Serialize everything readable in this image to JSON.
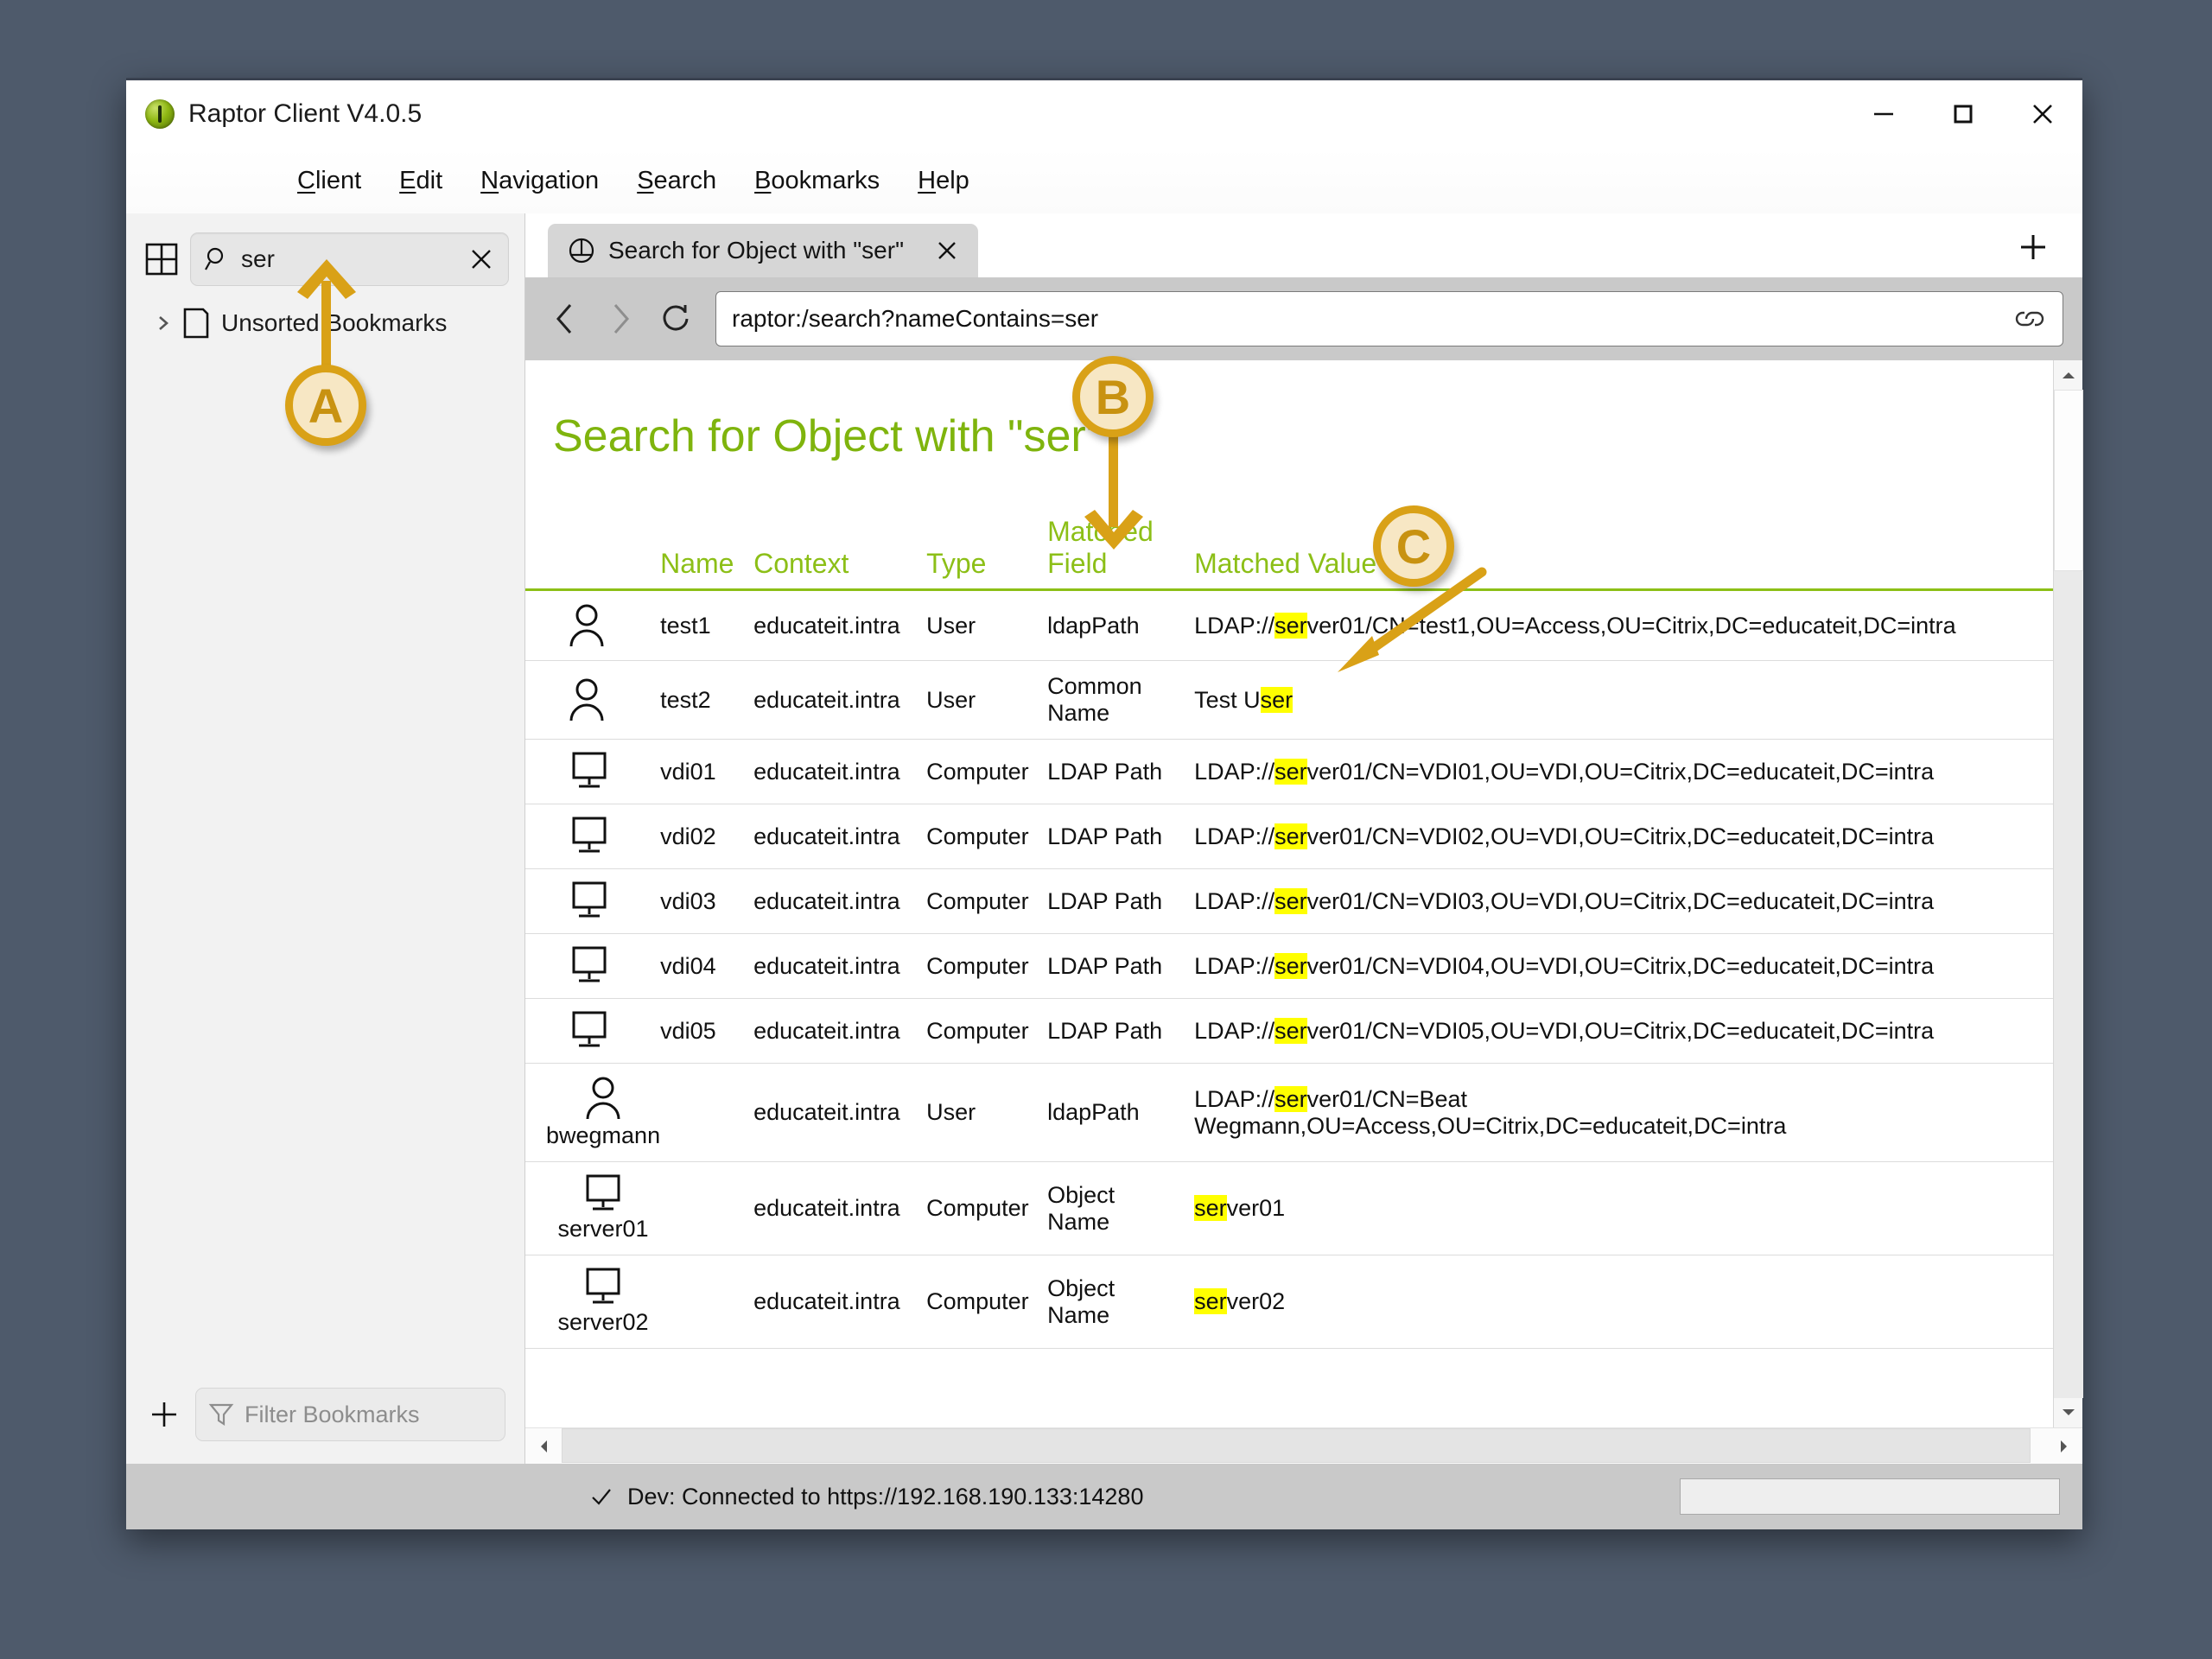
{
  "window": {
    "title": "Raptor Client V4.0.5",
    "controls": {
      "minimize": "minimize-button",
      "maximize": "maximize-button",
      "close": "close-button"
    }
  },
  "menubar": [
    {
      "label": "Client",
      "mnemonic": "C"
    },
    {
      "label": "Edit",
      "mnemonic": "E"
    },
    {
      "label": "Navigation",
      "mnemonic": "N"
    },
    {
      "label": "Search",
      "mnemonic": "S"
    },
    {
      "label": "Bookmarks",
      "mnemonic": "B"
    },
    {
      "label": "Help",
      "mnemonic": "H"
    }
  ],
  "sidebar": {
    "search": {
      "value": "ser",
      "placeholder": ""
    },
    "tree": [
      {
        "label": "Unsorted Bookmarks"
      }
    ],
    "filter": {
      "placeholder": "Filter Bookmarks"
    },
    "add_label": "+"
  },
  "tabs": {
    "active": "Search for Object with \"ser\"",
    "new_tab_label": "+"
  },
  "navbar": {
    "url": "raptor:/search?nameContains=ser"
  },
  "page": {
    "heading": "Search for Object with \"ser\"",
    "columns": [
      "",
      "Name",
      "Context",
      "Type",
      "Matched Field",
      "Matched Value"
    ],
    "rows": [
      {
        "icon": "user-icon",
        "name": "test1",
        "name_layout": "inline",
        "context": "educateit.intra",
        "type": "User",
        "field": "ldapPath",
        "value_pre": "LDAP://",
        "value_hl": "ser",
        "value_post": "ver01/CN=test1,OU=Access,OU=Citrix,DC=educateit,DC=intra"
      },
      {
        "icon": "user-icon",
        "name": "test2",
        "name_layout": "inline",
        "context": "educateit.intra",
        "type": "User",
        "field": "Common Name",
        "value_pre": "Test U",
        "value_hl": "ser",
        "value_post": ""
      },
      {
        "icon": "computer-icon",
        "name": "vdi01",
        "name_layout": "inline",
        "context": "educateit.intra",
        "type": "Computer",
        "field": "LDAP Path",
        "value_pre": "LDAP://",
        "value_hl": "ser",
        "value_post": "ver01/CN=VDI01,OU=VDI,OU=Citrix,DC=educateit,DC=intra"
      },
      {
        "icon": "computer-icon",
        "name": "vdi02",
        "name_layout": "inline",
        "context": "educateit.intra",
        "type": "Computer",
        "field": "LDAP Path",
        "value_pre": "LDAP://",
        "value_hl": "ser",
        "value_post": "ver01/CN=VDI02,OU=VDI,OU=Citrix,DC=educateit,DC=intra"
      },
      {
        "icon": "computer-icon",
        "name": "vdi03",
        "name_layout": "inline",
        "context": "educateit.intra",
        "type": "Computer",
        "field": "LDAP Path",
        "value_pre": "LDAP://",
        "value_hl": "ser",
        "value_post": "ver01/CN=VDI03,OU=VDI,OU=Citrix,DC=educateit,DC=intra"
      },
      {
        "icon": "computer-icon",
        "name": "vdi04",
        "name_layout": "inline",
        "context": "educateit.intra",
        "type": "Computer",
        "field": "LDAP Path",
        "value_pre": "LDAP://",
        "value_hl": "ser",
        "value_post": "ver01/CN=VDI04,OU=VDI,OU=Citrix,DC=educateit,DC=intra"
      },
      {
        "icon": "computer-icon",
        "name": "vdi05",
        "name_layout": "inline",
        "context": "educateit.intra",
        "type": "Computer",
        "field": "LDAP Path",
        "value_pre": "LDAP://",
        "value_hl": "ser",
        "value_post": "ver01/CN=VDI05,OU=VDI,OU=Citrix,DC=educateit,DC=intra"
      },
      {
        "icon": "user-icon",
        "name": "bwegmann",
        "name_layout": "stacked",
        "context": "educateit.intra",
        "type": "User",
        "field": "ldapPath",
        "value_pre": "LDAP://",
        "value_hl": "ser",
        "value_post": "ver01/CN=Beat Wegmann,OU=Access,OU=Citrix,DC=educateit,DC=intra"
      },
      {
        "icon": "computer-icon",
        "name": "server01",
        "name_layout": "stacked",
        "context": "educateit.intra",
        "type": "Computer",
        "field": "Object Name",
        "value_pre": "",
        "value_hl": "ser",
        "value_post": "ver01"
      },
      {
        "icon": "computer-icon",
        "name": "server02",
        "name_layout": "stacked",
        "context": "educateit.intra",
        "type": "Computer",
        "field": "Object Name",
        "value_pre": "",
        "value_hl": "ser",
        "value_post": "ver02"
      }
    ]
  },
  "statusbar": {
    "text": "Dev: Connected to https://192.168.190.133:14280"
  },
  "annotations": [
    {
      "id": "A",
      "label": "A",
      "target": "bookmark-search-input"
    },
    {
      "id": "B",
      "label": "B",
      "target": "matched-field-column-header"
    },
    {
      "id": "C",
      "label": "C",
      "target": "matched-value-cell"
    }
  ],
  "colors": {
    "accent_green": "#8cbf17",
    "heading_green": "#7fb40d",
    "highlight_yellow": "#ffff00",
    "annotation_orange": "#d9a117",
    "annotation_fill": "#f7e7c4",
    "desktop": "#4e5a6b"
  }
}
